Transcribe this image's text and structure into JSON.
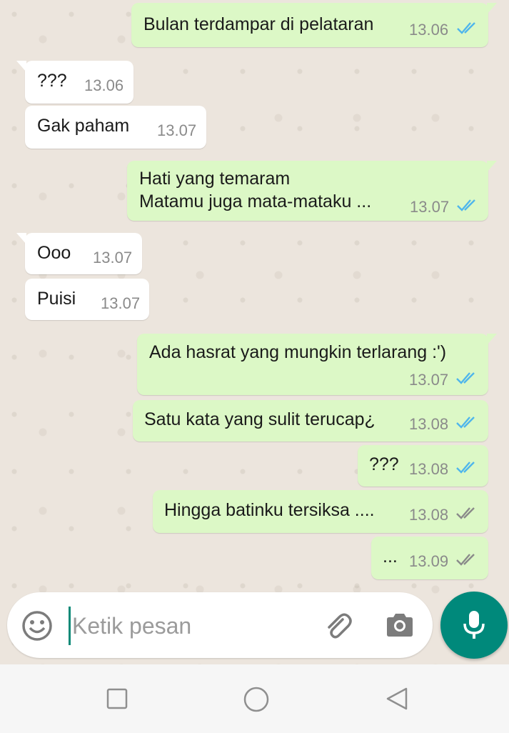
{
  "messages": [
    {
      "dir": "out",
      "text": "Bulan terdampar di pelataran",
      "time": "13.06",
      "status": "read"
    },
    {
      "dir": "in",
      "text": "???",
      "time": "13.06"
    },
    {
      "dir": "in",
      "text": "Gak paham",
      "time": "13.07"
    },
    {
      "dir": "out",
      "text": "Hati yang temaram\nMatamu juga mata-mataku ...",
      "time": "13.07",
      "status": "read"
    },
    {
      "dir": "in",
      "text": "Ooo",
      "time": "13.07"
    },
    {
      "dir": "in",
      "text": "Puisi",
      "time": "13.07"
    },
    {
      "dir": "out",
      "text": "Ada hasrat yang mungkin terlarang :')",
      "time": "13.07",
      "status": "read"
    },
    {
      "dir": "out",
      "text": "Satu kata yang sulit terucap¿",
      "time": "13.08",
      "status": "read"
    },
    {
      "dir": "out",
      "text": "???",
      "time": "13.08",
      "status": "read"
    },
    {
      "dir": "out",
      "text": "Hingga batinku tersiksa ....",
      "time": "13.08",
      "status": "delivered"
    },
    {
      "dir": "out",
      "text": "...",
      "time": "13.09",
      "status": "delivered"
    }
  ],
  "composer": {
    "placeholder": "Ketik pesan",
    "emoji_icon": "emoji-icon",
    "attach_icon": "paperclip-icon",
    "camera_icon": "camera-icon",
    "mic_icon": "microphone-icon"
  },
  "navbar": {
    "back_icon": "triangle-back-icon",
    "home_icon": "circle-home-icon",
    "recents_icon": "square-recents-icon"
  },
  "colors": {
    "chat_background": "#ece5dd",
    "outgoing_bubble": "#dcf8c6",
    "incoming_bubble": "#ffffff",
    "read_ticks": "#4fb6ec",
    "delivered_ticks": "#8a8a8a",
    "accent": "#00897b"
  }
}
